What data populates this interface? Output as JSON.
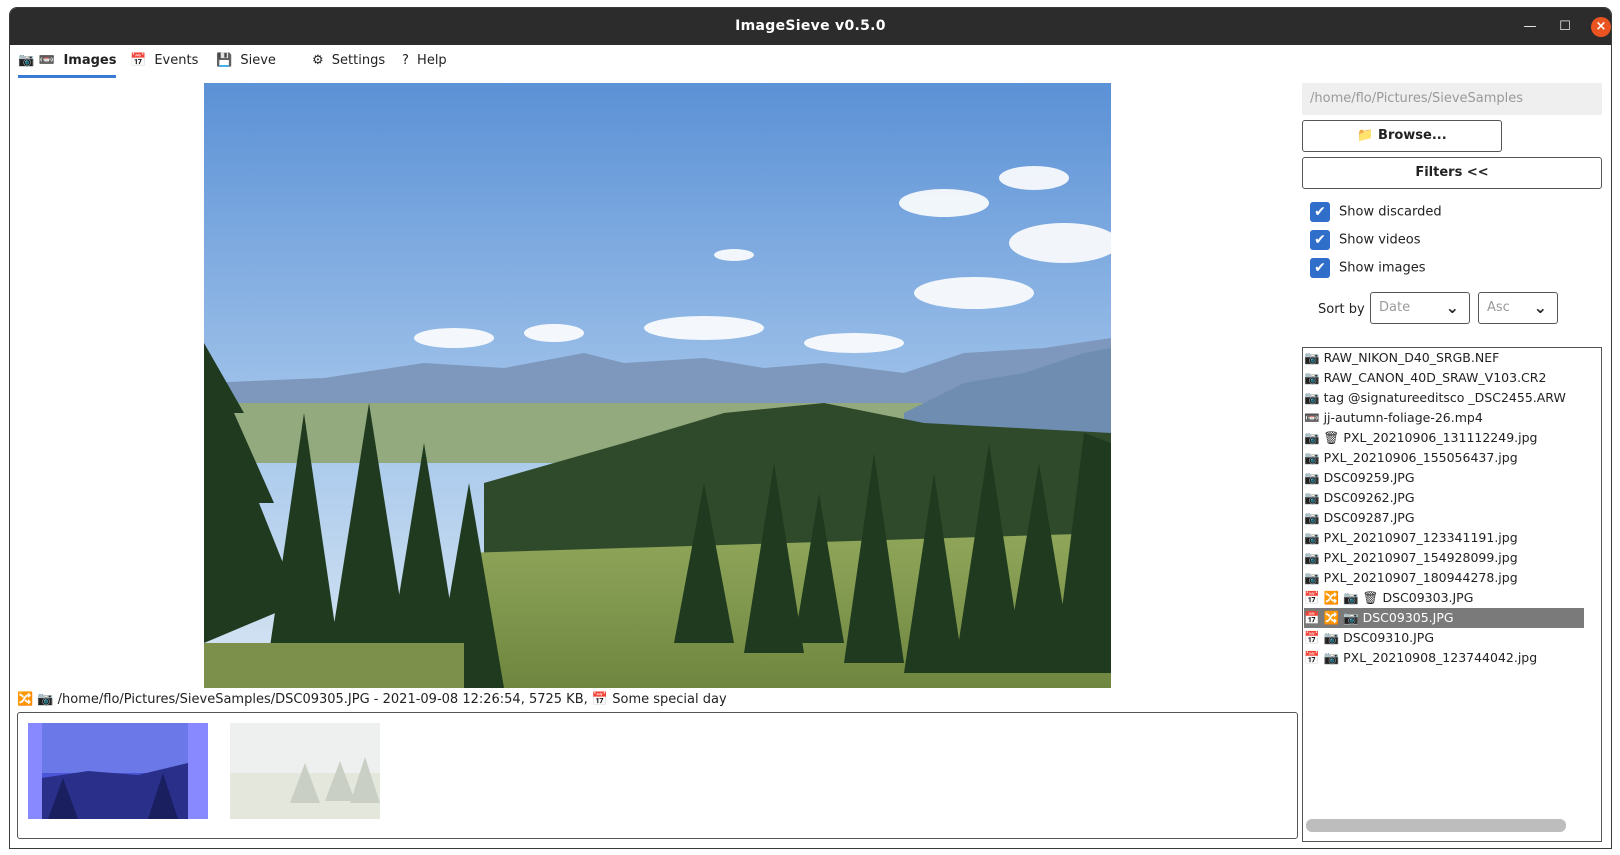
{
  "window": {
    "title": "ImageSieve v0.5.0"
  },
  "tabs": [
    {
      "icon": "📷 📼",
      "label": "Images",
      "active": true
    },
    {
      "icon": "📅",
      "label": "Events"
    },
    {
      "icon": "💾",
      "label": "Sieve"
    },
    {
      "icon": "⚙",
      "label": "Settings"
    },
    {
      "icon": "?",
      "label": "Help"
    }
  ],
  "status_line": {
    "icons": "🔀 📷",
    "text": "/home/flo/Pictures/SieveSamples/DSC09305.JPG - 2021-09-08 12:26:54, 5725 KB,",
    "event_icon": "📅",
    "event": "Some special day"
  },
  "panel": {
    "path": "/home/flo/Pictures/SieveSamples",
    "browse_icon": "📁",
    "browse_label": "Browse...",
    "filters_label": "Filters <<",
    "show_discarded": "Show discarded",
    "show_videos": "Show videos",
    "show_images": "Show images",
    "sort_by_label": "Sort by",
    "sort_field": "Date",
    "sort_order": "Asc"
  },
  "files": [
    {
      "icons": "📷",
      "name": "RAW_NIKON_D40_SRGB.NEF"
    },
    {
      "icons": "📷",
      "name": "RAW_CANON_40D_SRAW_V103.CR2"
    },
    {
      "icons": "📷",
      "name": "tag @signatureeditsco _DSC2455.ARW"
    },
    {
      "icons": "📼",
      "name": "jj-autumn-foliage-26.mp4"
    },
    {
      "icons": "📷 🗑",
      "name": "PXL_20210906_131112249.jpg"
    },
    {
      "icons": "📷",
      "name": "PXL_20210906_155056437.jpg"
    },
    {
      "icons": "📷",
      "name": "DSC09259.JPG"
    },
    {
      "icons": "📷",
      "name": "DSC09262.JPG"
    },
    {
      "icons": "📷",
      "name": "DSC09287.JPG"
    },
    {
      "icons": "📷",
      "name": "PXL_20210907_123341191.jpg"
    },
    {
      "icons": "📷",
      "name": "PXL_20210907_154928099.jpg"
    },
    {
      "icons": "📷",
      "name": "PXL_20210907_180944278.jpg"
    },
    {
      "icons": "📅 🔀 📷 🗑",
      "name": "DSC09303.JPG"
    },
    {
      "icons": "📅 🔀 📷",
      "name": "DSC09305.JPG",
      "selected": true
    },
    {
      "icons": "📅 📷",
      "name": "DSC09310.JPG"
    },
    {
      "icons": "📅 📷",
      "name": "PXL_20210908_123744042.jpg"
    }
  ],
  "colors": {
    "titlebar": "#2c2c2c",
    "accent": "#2f6fc9",
    "close": "#e95420",
    "selection": "#7a7a7a"
  }
}
